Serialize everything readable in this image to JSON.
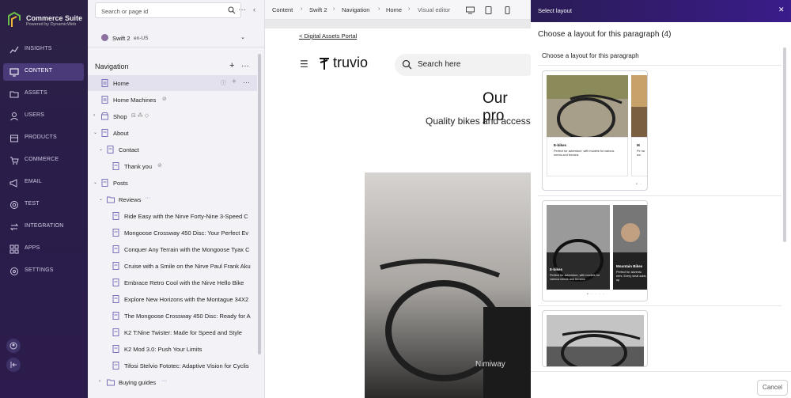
{
  "brand": {
    "name": "Commerce Suite",
    "tagline": "Powered by DynamicWeb"
  },
  "appnav": {
    "items": [
      {
        "label": "INSIGHTS",
        "icon": "insights-icon"
      },
      {
        "label": "CONTENT",
        "icon": "content-icon",
        "active": true
      },
      {
        "label": "ASSETS",
        "icon": "folder-icon"
      },
      {
        "label": "USERS",
        "icon": "user-icon"
      },
      {
        "label": "PRODUCTS",
        "icon": "box-icon"
      },
      {
        "label": "COMMERCE",
        "icon": "cart-icon"
      },
      {
        "label": "EMAIL",
        "icon": "megaphone-icon"
      },
      {
        "label": "TEST",
        "icon": "target-icon"
      },
      {
        "label": "INTEGRATION",
        "icon": "sync-icon"
      },
      {
        "label": "APPS",
        "icon": "grid-icon"
      },
      {
        "label": "SETTINGS",
        "icon": "gear-icon"
      }
    ]
  },
  "tree": {
    "search_placeholder": "Search or page id",
    "site_name": "Swift 2",
    "site_locale": "en-US",
    "heading": "Navigation",
    "rows": [
      {
        "label": "Home"
      },
      {
        "label": "Home Machines"
      },
      {
        "label": "Shop"
      },
      {
        "label": "About"
      },
      {
        "label": "Contact"
      },
      {
        "label": "Thank you"
      },
      {
        "label": "Posts"
      },
      {
        "label": "Reviews"
      },
      {
        "label": "Ride Easy with the Nirve Forty-Nine 3-Speed C"
      },
      {
        "label": "Mongoose Crossway 450 Disc: Your Perfect Ev"
      },
      {
        "label": "Conquer Any Terrain with the Mongoose Tyax C"
      },
      {
        "label": "Cruise with a Smile on the Nirve Paul Frank Aku"
      },
      {
        "label": "Embrace Retro Cool with the Nirve Hello Bike"
      },
      {
        "label": "Explore New Horizons with the Montague 34X2"
      },
      {
        "label": "The Mongoose Crossway 450 Disc: Ready for A"
      },
      {
        "label": "K2 T:Nine Twister: Made for Speed and Style"
      },
      {
        "label": "K2 Mod 3.0: Push Your Limits"
      },
      {
        "label": "Tifosi Stelvio Fototec: Adaptive Vision for Cyclis"
      },
      {
        "label": "Buying guides"
      }
    ]
  },
  "topbar": {
    "crumbs": [
      "Content",
      "Swift 2",
      "Navigation",
      "Home",
      "Visual editor"
    ]
  },
  "preview": {
    "link": "< Digital Assets Portal",
    "logo_text": "truvio",
    "search_placeholder": "Search here",
    "hero_title": "Our pro",
    "hero_sub": "Quality bikes and access",
    "bike_label": "Nimiway"
  },
  "modal": {
    "header": "Select layout",
    "title": "Choose a layout for this paragraph (4)",
    "subtitle": "Choose a layout for this paragraph",
    "card1": {
      "title": "E-bikes",
      "desc": "Perfect for adventure, with models for various needs and terrains",
      "title2": "M",
      "desc2": "Pe na wo"
    },
    "card2": {
      "title": "E-bikes",
      "desc": "Perfect for adventure, with models for various needs and terrains",
      "title2": "Mountain Bikes",
      "desc2": "Perfect for adventu ners. Every smal adds up"
    },
    "cancel_label": "Cancel"
  },
  "colors": {
    "sidebar_bg": "#2b1d4a",
    "modal_header": "#3a1c8a",
    "active_nav": "#4a3a7a"
  }
}
